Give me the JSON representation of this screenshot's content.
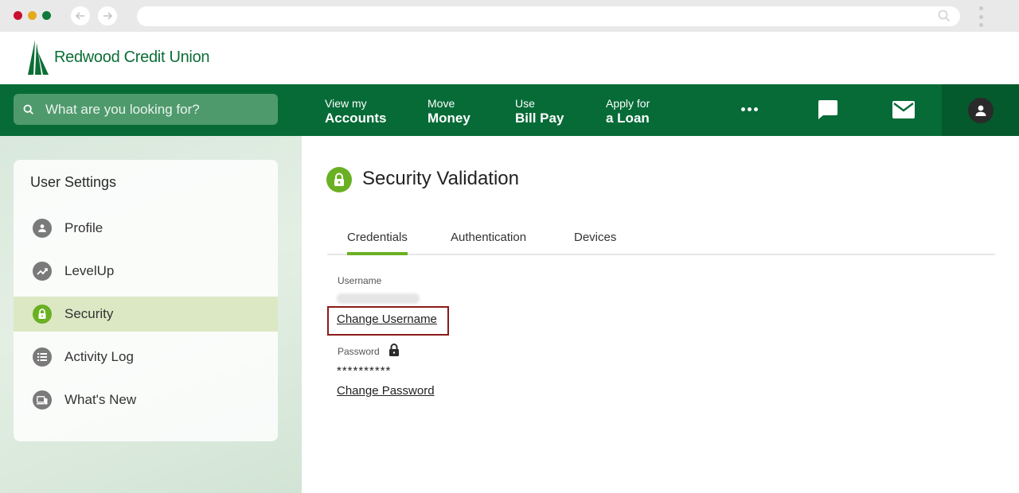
{
  "brand": {
    "name": "Redwood Credit Union",
    "primary_color": "#066b37",
    "accent_color": "#6ab023",
    "highlight_color": "#8b1a1a"
  },
  "search": {
    "placeholder": "What are you looking for?",
    "icon": "search-icon"
  },
  "nav": {
    "items": [
      {
        "line1": "View my",
        "line2": "Accounts"
      },
      {
        "line1": "Move",
        "line2": "Money"
      },
      {
        "line1": "Use",
        "line2": "Bill Pay"
      },
      {
        "line1": "Apply for",
        "line2": "a Loan"
      }
    ],
    "icons": [
      "more-icon",
      "chat-icon",
      "mail-icon",
      "user-icon"
    ]
  },
  "sidebar": {
    "title": "User Settings",
    "items": [
      {
        "label": "Profile",
        "icon": "person-icon",
        "active": false
      },
      {
        "label": "LevelUp",
        "icon": "trending-icon",
        "active": false
      },
      {
        "label": "Security",
        "icon": "lock-icon",
        "active": true
      },
      {
        "label": "Activity Log",
        "icon": "list-icon",
        "active": false
      },
      {
        "label": "What's New",
        "icon": "devices-icon",
        "active": false
      }
    ]
  },
  "main": {
    "title": "Security Validation",
    "title_icon": "lock-icon",
    "tabs": [
      {
        "label": "Credentials",
        "active": true
      },
      {
        "label": "Authentication",
        "active": false
      },
      {
        "label": "Devices",
        "active": false
      }
    ],
    "username": {
      "label": "Username",
      "link": "Change Username"
    },
    "password": {
      "label": "Password",
      "mask": "**********",
      "link": "Change Password"
    }
  }
}
